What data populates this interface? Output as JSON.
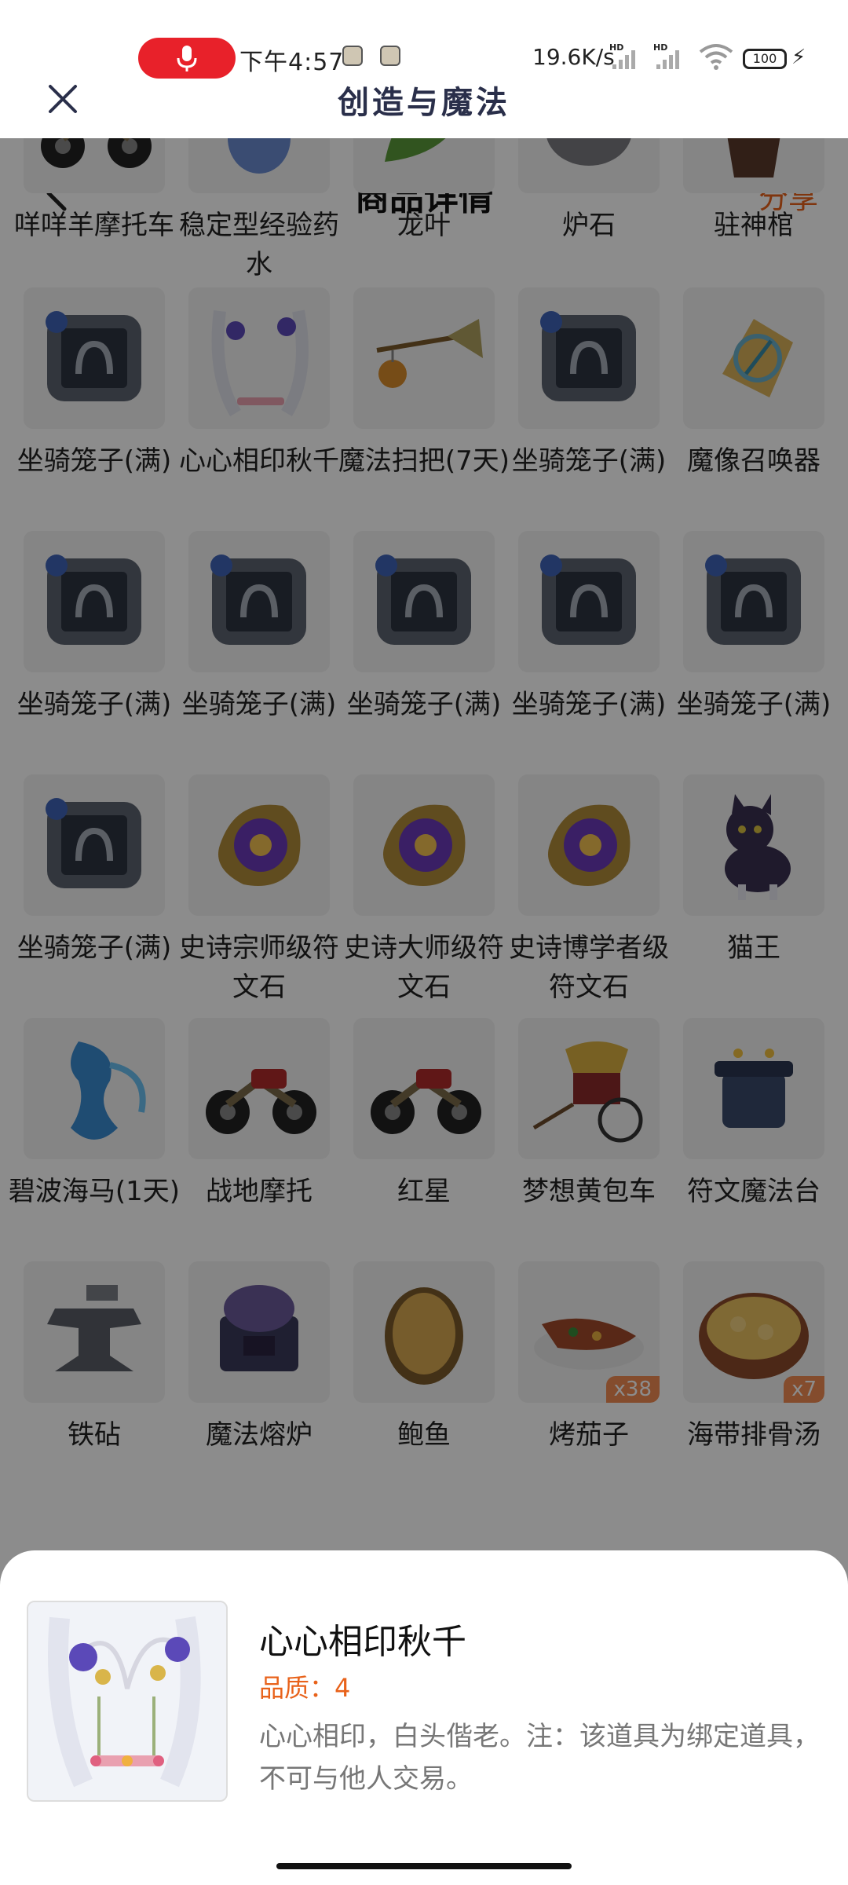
{
  "status_bar": {
    "time": "下午4:57",
    "net_speed": "19.6K/s",
    "battery": "100",
    "hd1": "HD",
    "hd2": "HD"
  },
  "app": {
    "title": "创造与魔法"
  },
  "nav": {
    "title": "商品详情",
    "share": "分享"
  },
  "grid_items": [
    {
      "name": "咩咩羊摩托车",
      "icon": "motorcycle-icon"
    },
    {
      "name": "稳定型经验药水",
      "icon": "potion-icon",
      "top_badge": true
    },
    {
      "name": "龙叶",
      "icon": "leaf-icon",
      "top_badge": true
    },
    {
      "name": "炉石",
      "icon": "stone-icon"
    },
    {
      "name": "驻神棺",
      "icon": "coffin-icon"
    },
    {
      "name": "坐骑笼子(满)",
      "icon": "cage-icon"
    },
    {
      "name": "心心相印秋千",
      "icon": "swing-icon"
    },
    {
      "name": "魔法扫把(7天)",
      "icon": "broom-icon"
    },
    {
      "name": "坐骑笼子(满)",
      "icon": "cage-icon"
    },
    {
      "name": "魔像召唤器",
      "icon": "summoner-icon"
    },
    {
      "name": "坐骑笼子(满)",
      "icon": "cage-icon"
    },
    {
      "name": "坐骑笼子(满)",
      "icon": "cage-icon"
    },
    {
      "name": "坐骑笼子(满)",
      "icon": "cage-icon"
    },
    {
      "name": "坐骑笼子(满)",
      "icon": "cage-icon"
    },
    {
      "name": "坐骑笼子(满)",
      "icon": "cage-icon"
    },
    {
      "name": "坐骑笼子(满)",
      "icon": "cage-icon"
    },
    {
      "name": "史诗宗师级符文石",
      "icon": "rune-icon"
    },
    {
      "name": "史诗大师级符文石",
      "icon": "rune-icon"
    },
    {
      "name": "史诗博学者级符文石",
      "icon": "rune-icon"
    },
    {
      "name": "猫王",
      "icon": "cat-icon"
    },
    {
      "name": "碧波海马(1天)",
      "icon": "seahorse-icon"
    },
    {
      "name": "战地摩托",
      "icon": "motorcycle-icon"
    },
    {
      "name": "红星",
      "icon": "motorcycle-icon"
    },
    {
      "name": "梦想黄包车",
      "icon": "rickshaw-icon"
    },
    {
      "name": "符文魔法台",
      "icon": "altar-icon"
    },
    {
      "name": "铁砧",
      "icon": "anvil-icon"
    },
    {
      "name": "魔法熔炉",
      "icon": "furnace-icon"
    },
    {
      "name": "鲍鱼",
      "icon": "abalone-icon"
    },
    {
      "name": "烤茄子",
      "icon": "eggplant-icon",
      "badge": "x38"
    },
    {
      "name": "海带排骨汤",
      "icon": "soup-icon",
      "badge": "x7"
    }
  ],
  "sheet": {
    "name": "心心相印秋千",
    "quality": "品质：4",
    "description": "心心相印，白头偕老。注：该道具为绑定道具，不可与他人交易。"
  },
  "colors": {
    "accent": "#e8621a",
    "record": "#e8212a"
  }
}
